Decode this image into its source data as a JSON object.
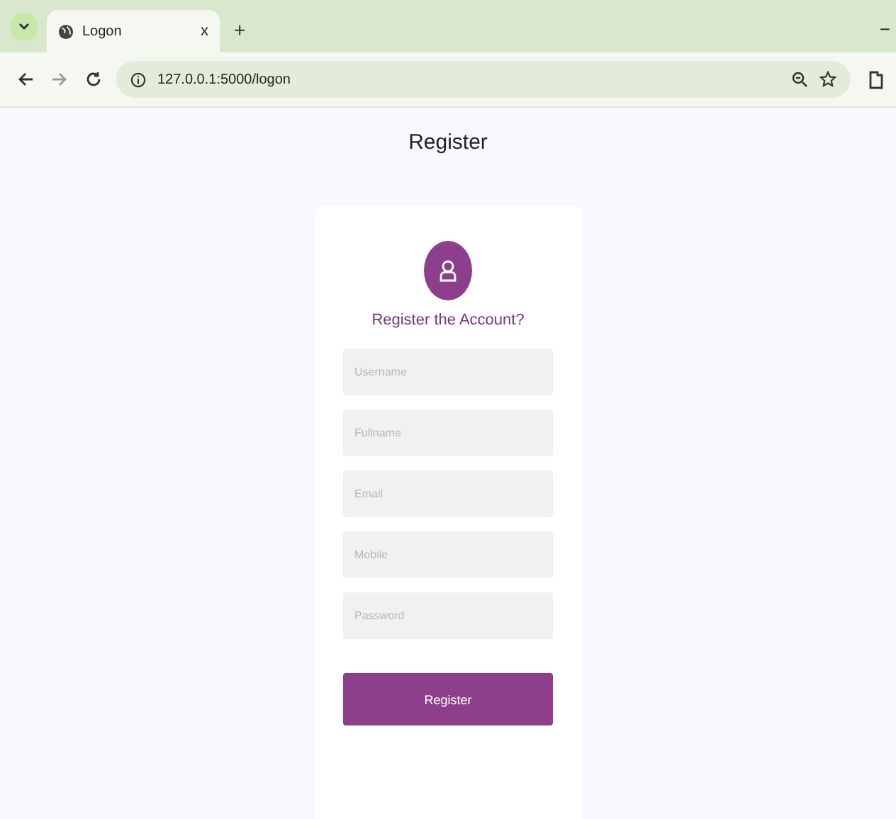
{
  "browser": {
    "tab_title": "Logon",
    "tab_close": "x",
    "new_tab": "+",
    "minimize": "−",
    "address": "127.0.0.1:5000/logon"
  },
  "page": {
    "heading": "Register",
    "subtitle": "Register the Account?",
    "fields": [
      {
        "placeholder": "Username"
      },
      {
        "placeholder": "Fullname"
      },
      {
        "placeholder": "Email"
      },
      {
        "placeholder": "Mobile"
      },
      {
        "placeholder": "Password"
      }
    ],
    "submit": "Register"
  }
}
